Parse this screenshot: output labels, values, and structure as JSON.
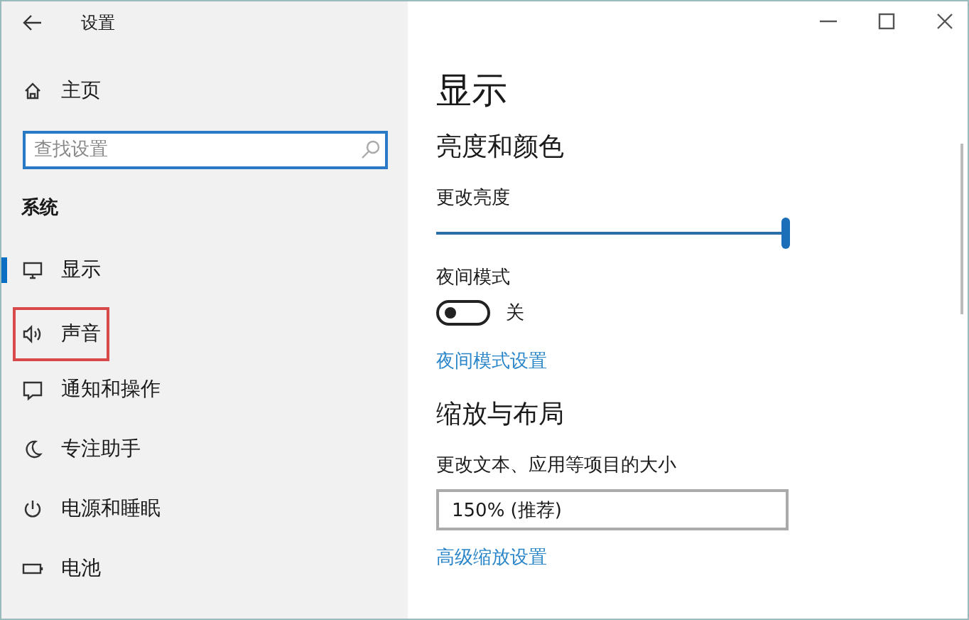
{
  "window": {
    "title": "设置"
  },
  "sidebar": {
    "home": "主页",
    "search": {
      "placeholder": "查找设置"
    },
    "section": "系统",
    "items": [
      {
        "kind": "display",
        "label": "显示",
        "selected": true,
        "highlighted": false
      },
      {
        "kind": "sound",
        "label": "声音",
        "selected": false,
        "highlighted": true
      },
      {
        "kind": "notify",
        "label": "通知和操作",
        "selected": false,
        "highlighted": false
      },
      {
        "kind": "focus",
        "label": "专注助手",
        "selected": false,
        "highlighted": false
      },
      {
        "kind": "power",
        "label": "电源和睡眠",
        "selected": false,
        "highlighted": false
      },
      {
        "kind": "battery",
        "label": "电池",
        "selected": false,
        "highlighted": false
      }
    ]
  },
  "content": {
    "title": "显示",
    "brightness": {
      "heading": "亮度和颜色",
      "label": "更改亮度",
      "level": 1
    },
    "night_mode": {
      "label": "夜间模式",
      "on": false,
      "state_text": "关",
      "link": "夜间模式设置"
    },
    "scale": {
      "heading": "缩放与布局",
      "label": "更改文本、应用等项目的大小",
      "value": "150% (推荐)",
      "link": "高级缩放设置"
    }
  }
}
